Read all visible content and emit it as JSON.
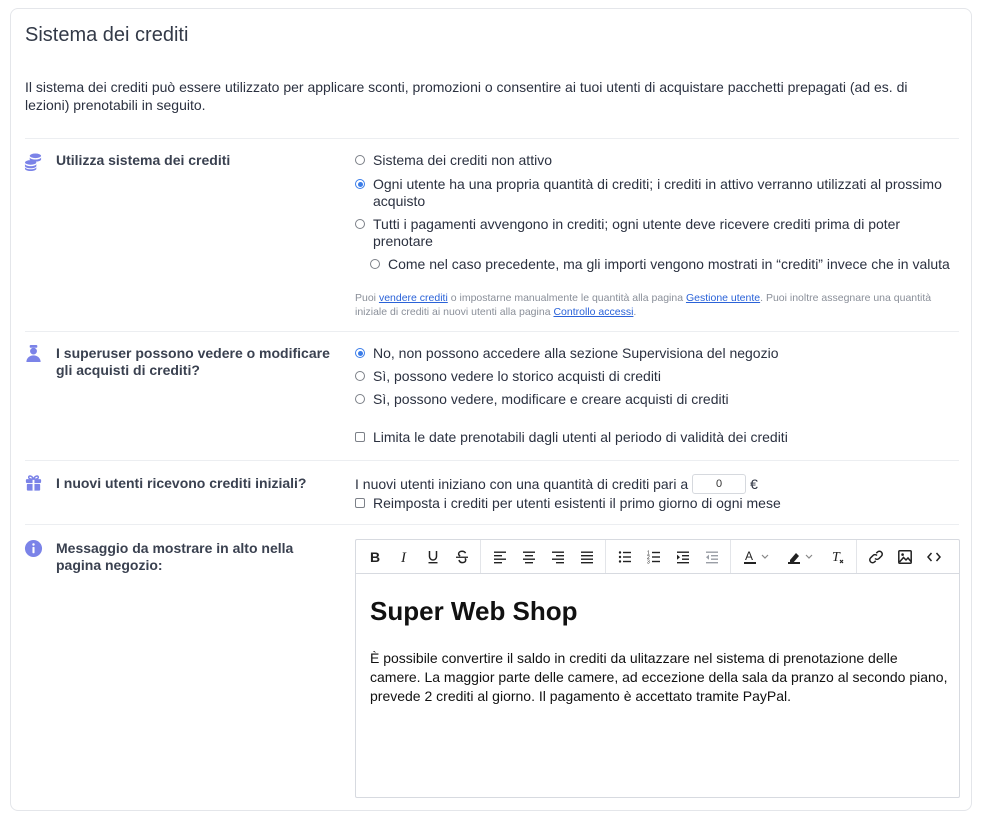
{
  "card": {
    "title": "Sistema dei crediti",
    "intro": "Il sistema dei crediti può essere utilizzato per applicare sconti, promozioni o consentire ai tuoi utenti di acquistare pacchetti prepagati (ad es. di lezioni) prenotabili in seguito."
  },
  "credit_system": {
    "label": "Utilizza sistema dei crediti",
    "icon": "coins-icon",
    "options": [
      {
        "label": "Sistema dei crediti non attivo",
        "checked": false
      },
      {
        "label": "Ogni utente ha una propria quantità di crediti; i crediti in attivo verranno utilizzati al prossimo acquisto",
        "checked": true
      },
      {
        "label": "Tutti i pagamenti avvengono in crediti; ogni utente deve ricevere crediti prima di poter prenotare",
        "checked": false
      },
      {
        "label": "Come nel caso precedente, ma gli importi vengono mostrati in “crediti” invece che in valuta",
        "checked": false
      }
    ],
    "note": {
      "t1": "Puoi ",
      "link1": "vendere crediti",
      "t2": " o impostarne manualmente le quantità alla pagina ",
      "link2": "Gestione utente",
      "t3": ". Puoi inoltre assegnare una quantità iniziale di crediti ai nuovi utenti alla pagina ",
      "link3": "Controllo accessi",
      "t4": "."
    }
  },
  "superuser": {
    "label": "I superuser possono vedere o modificare gli acquisti di crediti?",
    "icon": "user-icon",
    "options": [
      {
        "label": "No, non possono accedere alla sezione Supervisiona del negozio",
        "checked": true
      },
      {
        "label": "Sì, possono vedere lo storico acquisti di crediti",
        "checked": false
      },
      {
        "label": "Sì, possono vedere, modificare e creare acquisti di crediti",
        "checked": false
      }
    ],
    "limit_checkbox": "Limita le date prenotabili dagli utenti al periodo di validità dei crediti"
  },
  "initial_credits": {
    "label": "I nuovi utenti ricevono crediti iniziali?",
    "icon": "gift-icon",
    "text_before": "I nuovi utenti iniziano con una quantità di crediti pari a",
    "value": "0",
    "currency": "€",
    "reset_checkbox": "Reimposta i crediti per utenti esistenti il primo giorno di ogni mese"
  },
  "message": {
    "label": "Messaggio da mostrare in alto nella pagina negozio:",
    "icon": "info-icon",
    "heading": "Super Web Shop",
    "body": "È possibile convertire il saldo in crediti da ulitazzare nel sistema di prenotazione delle camere. La maggior parte delle camere, ad eccezione della sala da pranzo al secondo piano, prevede 2 crediti al giorno. Il pagamento è accettato tramite PayPal."
  },
  "colors": {
    "accent": "#3b7de9",
    "icon": "#7b83e8",
    "link": "#2a62d8"
  }
}
